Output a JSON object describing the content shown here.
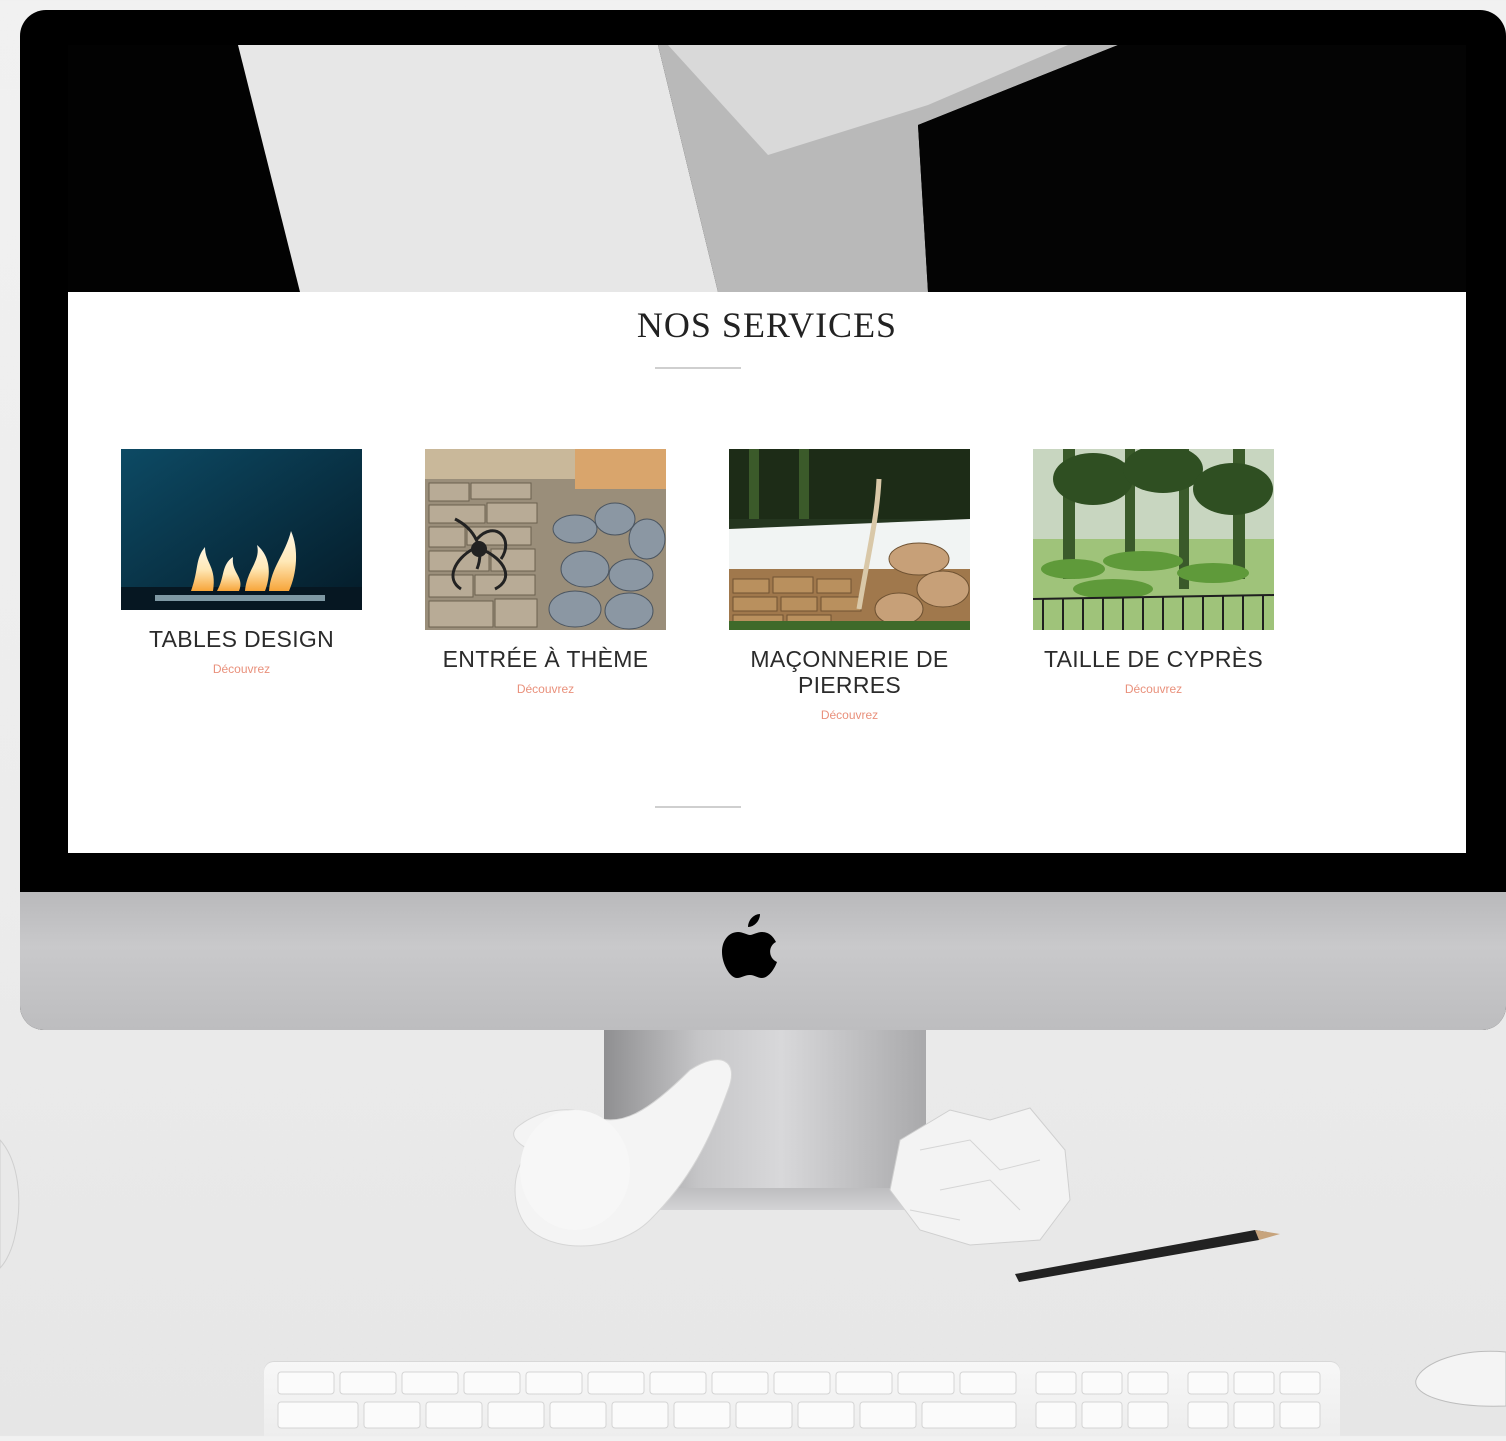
{
  "section": {
    "title": "NOS SERVICES"
  },
  "services": [
    {
      "name": "TABLES DESIGN",
      "link_label": "Découvrez",
      "image": "fire-table-photo"
    },
    {
      "name": "ENTRÉE À THÈME",
      "link_label": "Découvrez",
      "image": "stone-wall-sculpture-photo"
    },
    {
      "name": "MAÇONNERIE DE PIERRES",
      "link_label": "Découvrez",
      "image": "pool-stone-wall-photo"
    },
    {
      "name": "TAILLE DE CYPRÈS",
      "link_label": "Découvrez",
      "image": "garden-cypress-photo"
    }
  ],
  "colors": {
    "link": "#e9907b",
    "heading": "#222222",
    "page_background": "#ffffff"
  },
  "icons": {
    "monitor_logo": "apple-logo-icon"
  }
}
